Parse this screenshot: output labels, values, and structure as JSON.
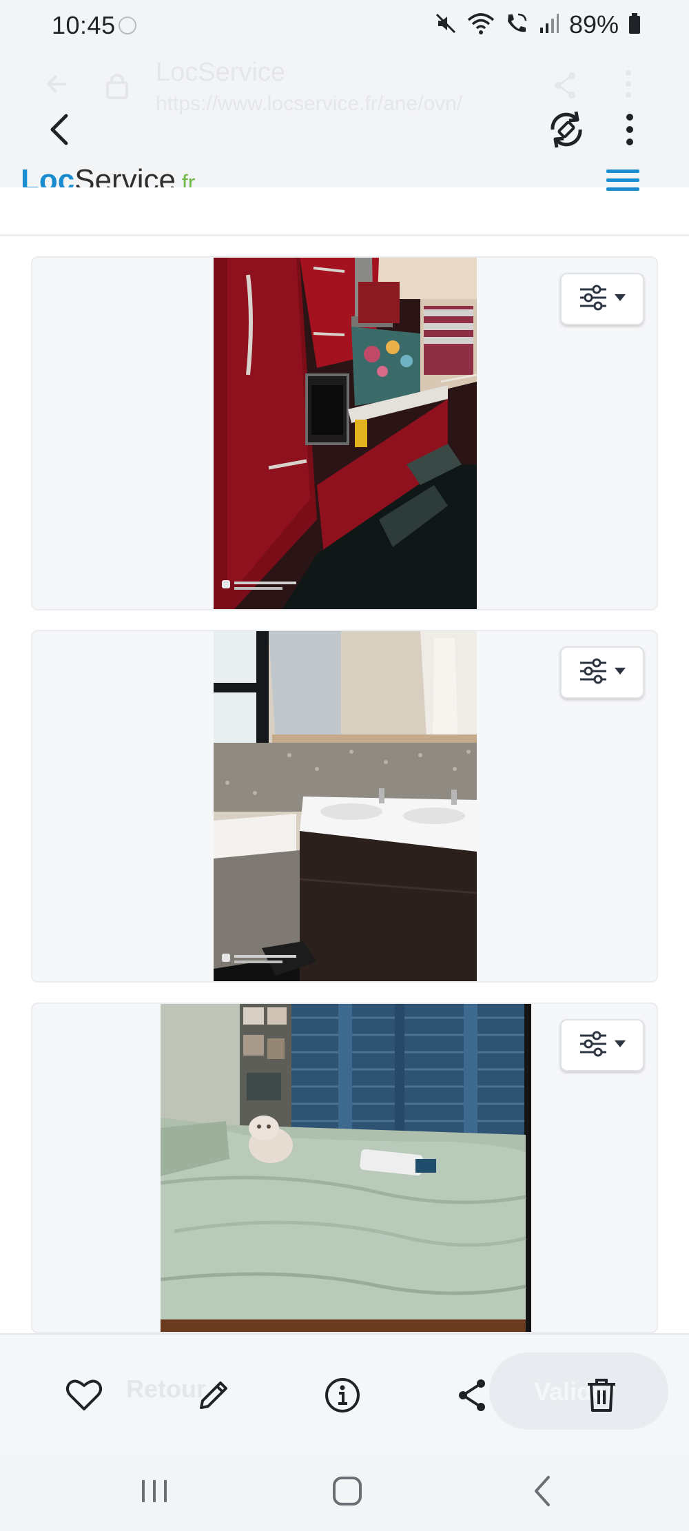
{
  "status_bar": {
    "time": "10:45",
    "battery_percent": "89%",
    "icons": [
      "mute-icon",
      "wifi-icon",
      "wifi-calling-icon",
      "signal-icon",
      "battery-icon"
    ]
  },
  "browser": {
    "page_title": "LocService",
    "url": "https://www.locservice.fr/ane/ovn/",
    "icons": [
      "back-arrow-icon",
      "rotate-icon",
      "more-vertical-icon"
    ]
  },
  "site": {
    "logo_part_a": "Loc",
    "logo_part_b": "Service",
    "logo_part_c": ".fr",
    "menu_icon": "hamburger-icon",
    "menu_color": "#1b8ccf"
  },
  "photos": [
    {
      "subject": "kitchen",
      "watermark_line1": "SHOT ON REDMI 9",
      "watermark_line2": "AI QUAD CAMERA",
      "options_icon": "sliders-icon"
    },
    {
      "subject": "bathroom",
      "watermark_line1": "SHOT ON REDMI 9",
      "watermark_line2": "AI QUAD CAMERA",
      "options_icon": "sliders-icon"
    },
    {
      "subject": "bedroom",
      "options_icon": "sliders-icon"
    }
  ],
  "action_bar": {
    "behind_left_label": "Retour",
    "behind_right_label": "Valider",
    "icons": [
      "heart-icon",
      "pencil-icon",
      "info-icon",
      "share-icon",
      "trash-icon"
    ]
  },
  "system_nav": {
    "icons": [
      "recents-icon",
      "home-icon",
      "back-chevron-icon"
    ]
  }
}
